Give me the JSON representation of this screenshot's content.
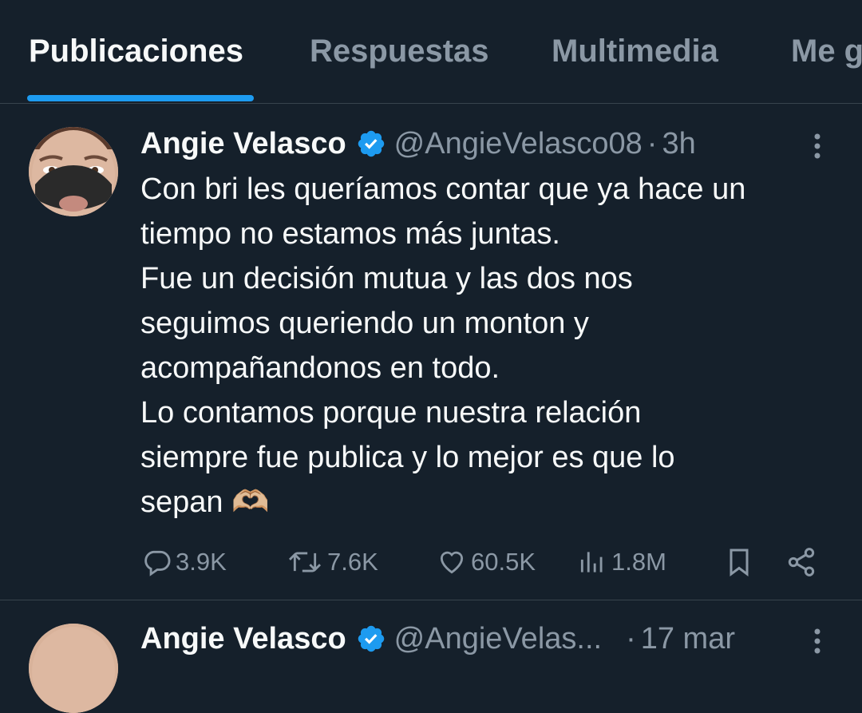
{
  "tabs": [
    {
      "label": "Publicaciones",
      "active": true
    },
    {
      "label": "Respuestas",
      "active": false
    },
    {
      "label": "Multimedia",
      "active": false
    },
    {
      "label": "Me g",
      "active": false
    }
  ],
  "tweets": [
    {
      "author_name": "Angie Velasco",
      "handle": "@AngieVelasco08",
      "separator": "·",
      "time": "3h",
      "verified": true,
      "text_lines": [
        "Con bri les queríamos contar que ya hace un",
        "tiempo no estamos más juntas.",
        "Fue un decisión mutua y las dos nos",
        "seguimos queriendo un monton y",
        "acompañandonos en todo.",
        "Lo contamos porque nuestra relación",
        "siempre fue publica y lo mejor es que lo",
        "sepan 🫶🏼"
      ],
      "stats": {
        "replies": "3.9K",
        "reposts": "7.6K",
        "likes": "60.5K",
        "views": "1.8M"
      }
    },
    {
      "author_name": "Angie Velasco",
      "handle": "@AngieVelas...",
      "separator": "·",
      "time": "17 mar",
      "verified": true
    }
  ],
  "colors": {
    "background": "#15202b",
    "accent": "#1d9bf0",
    "muted": "#8b98a5",
    "text": "#f7f9f9",
    "divider": "#38444d"
  },
  "icons": {
    "verified": "verified-badge-icon",
    "more": "more-vertical-icon",
    "reply": "reply-icon",
    "repost": "repost-icon",
    "like": "heart-icon",
    "views": "views-chart-icon",
    "bookmark": "bookmark-icon",
    "share": "share-icon"
  }
}
